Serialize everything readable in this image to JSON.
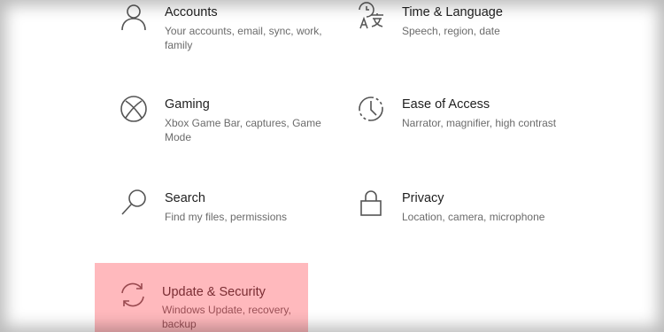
{
  "settings": {
    "tiles": [
      {
        "title": "Accounts",
        "desc": "Your accounts, email, sync, work, family",
        "icon": "person-icon"
      },
      {
        "title": "Time & Language",
        "desc": "Speech, region, date",
        "icon": "time-language-icon"
      },
      {
        "title": "Gaming",
        "desc": "Xbox Game Bar, captures, Game Mode",
        "icon": "xbox-icon"
      },
      {
        "title": "Ease of Access",
        "desc": "Narrator, magnifier, high contrast",
        "icon": "ease-of-access-icon"
      },
      {
        "title": "Search",
        "desc": "Find my files, permissions",
        "icon": "search-icon"
      },
      {
        "title": "Privacy",
        "desc": "Location, camera, microphone",
        "icon": "lock-icon"
      },
      {
        "title": "Update & Security",
        "desc": "Windows Update, recovery, backup",
        "icon": "refresh-icon"
      }
    ],
    "selected_tile": "Update & Security",
    "highlight_color": "#ffb9bd"
  }
}
